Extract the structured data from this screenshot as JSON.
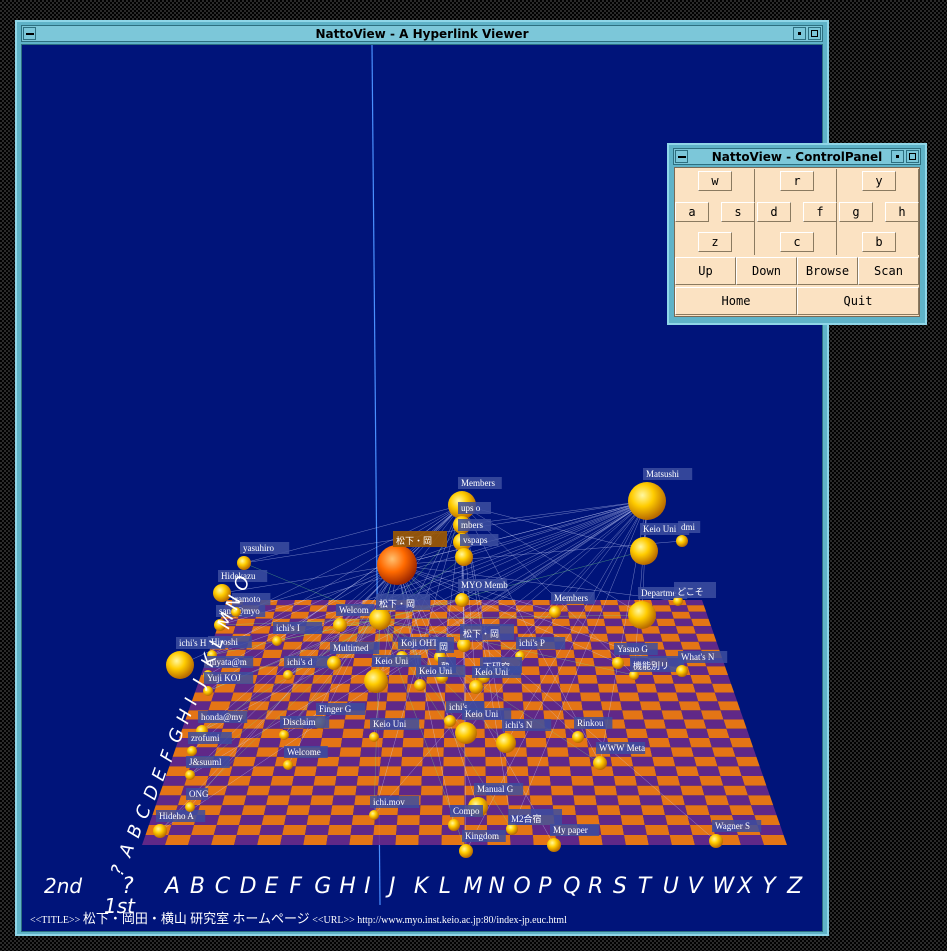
{
  "main_window": {
    "title": "NattoView - A Hyperlink Viewer",
    "status": {
      "title_tag": "<<TITLE>>",
      "title_text": "松下・岡田・横山 研究室 ホームページ",
      "url_tag": "<<URL>>",
      "url_text": "http://www.myo.inst.keio.ac.jp:80/index-jp.euc.html"
    }
  },
  "control_panel": {
    "title": "NattoView - ControlPanel",
    "pads": [
      {
        "up": "w",
        "left": "a",
        "right": "s",
        "down": "z"
      },
      {
        "up": "r",
        "left": "d",
        "right": "f",
        "down": "c"
      },
      {
        "up": "y",
        "left": "g",
        "right": "h",
        "down": "b"
      }
    ],
    "row1": [
      "Up",
      "Down",
      "Browse",
      "Scan"
    ],
    "row2": [
      "Home",
      "Quit"
    ]
  },
  "scene": {
    "colors": {
      "background": "#00147a",
      "node": "#ffcc00",
      "selected_node": "#ff6a00",
      "tile_a": "#f07a10",
      "tile_b": "#6a2a8a",
      "link": "#cfd6ff"
    },
    "x_axis_letters": [
      "A",
      "B",
      "C",
      "D",
      "E",
      "F",
      "G",
      "H",
      "I",
      "J",
      "K",
      "L",
      "M",
      "N",
      "O",
      "P",
      "Q",
      "R",
      "S",
      "T",
      "U",
      "V",
      "W",
      "X",
      "Y",
      "Z"
    ],
    "y_axis_letters": [
      "?",
      "A",
      "B",
      "C",
      "D",
      "E",
      "F",
      "G",
      "H",
      "I",
      "J",
      "K",
      "L",
      "M",
      "N",
      "O"
    ],
    "axis_labels": {
      "first": "1st",
      "second": "2nd",
      "question": "?"
    },
    "nodes": [
      {
        "label": "松下・岡",
        "selected": true
      },
      {
        "label": "Members"
      },
      {
        "label": "ups o"
      },
      {
        "label": "mbers"
      },
      {
        "label": "vspaps"
      },
      {
        "label": "Matsushi"
      },
      {
        "label": "Keio Uni"
      },
      {
        "label": "dmi"
      },
      {
        "label": "yasuhiro"
      },
      {
        "label": "Hidekazu"
      },
      {
        "label": "sano@myo"
      },
      {
        "label": "ramoto"
      },
      {
        "label": "Welcom"
      },
      {
        "label": "松下・岡"
      },
      {
        "label": "MYO Memb"
      },
      {
        "label": "Members"
      },
      {
        "label": "Departme"
      },
      {
        "label": "どこそ"
      },
      {
        "label": "ichi's I"
      },
      {
        "label": "ichi's H"
      },
      {
        "label": "Hiroshi"
      },
      {
        "label": "miyata@m"
      },
      {
        "label": "ichi's d"
      },
      {
        "label": "Multimed"
      },
      {
        "label": "Koji OHT"
      },
      {
        "label": "岡"
      },
      {
        "label": "松下・岡"
      },
      {
        "label": "ichi's P"
      },
      {
        "label": "塾"
      },
      {
        "label": "下研究"
      },
      {
        "label": "Keio Uni"
      },
      {
        "label": "Keio Uni"
      },
      {
        "label": "Yuji KOJ"
      },
      {
        "label": "Yasuo G"
      },
      {
        "label": "機能別リ"
      },
      {
        "label": "What's N"
      },
      {
        "label": "Keio Uni"
      },
      {
        "label": "Finger G"
      },
      {
        "label": "honda@my"
      },
      {
        "label": "ichi's"
      },
      {
        "label": "Keio Uni"
      },
      {
        "label": "Keio Uni"
      },
      {
        "label": "ichi's N"
      },
      {
        "label": "Rinkou"
      },
      {
        "label": "Disclaim"
      },
      {
        "label": "Welcome"
      },
      {
        "label": "WWW Meta"
      },
      {
        "label": "zrofumi"
      },
      {
        "label": "J&suuml"
      },
      {
        "label": "Manual G"
      },
      {
        "label": "ichi.mov"
      },
      {
        "label": "Compo"
      },
      {
        "label": "M2合宿"
      },
      {
        "label": "My paper"
      },
      {
        "label": "Kingdom"
      },
      {
        "label": "Wagner S"
      },
      {
        "label": "Hideho A"
      },
      {
        "label": "ONG"
      }
    ]
  }
}
